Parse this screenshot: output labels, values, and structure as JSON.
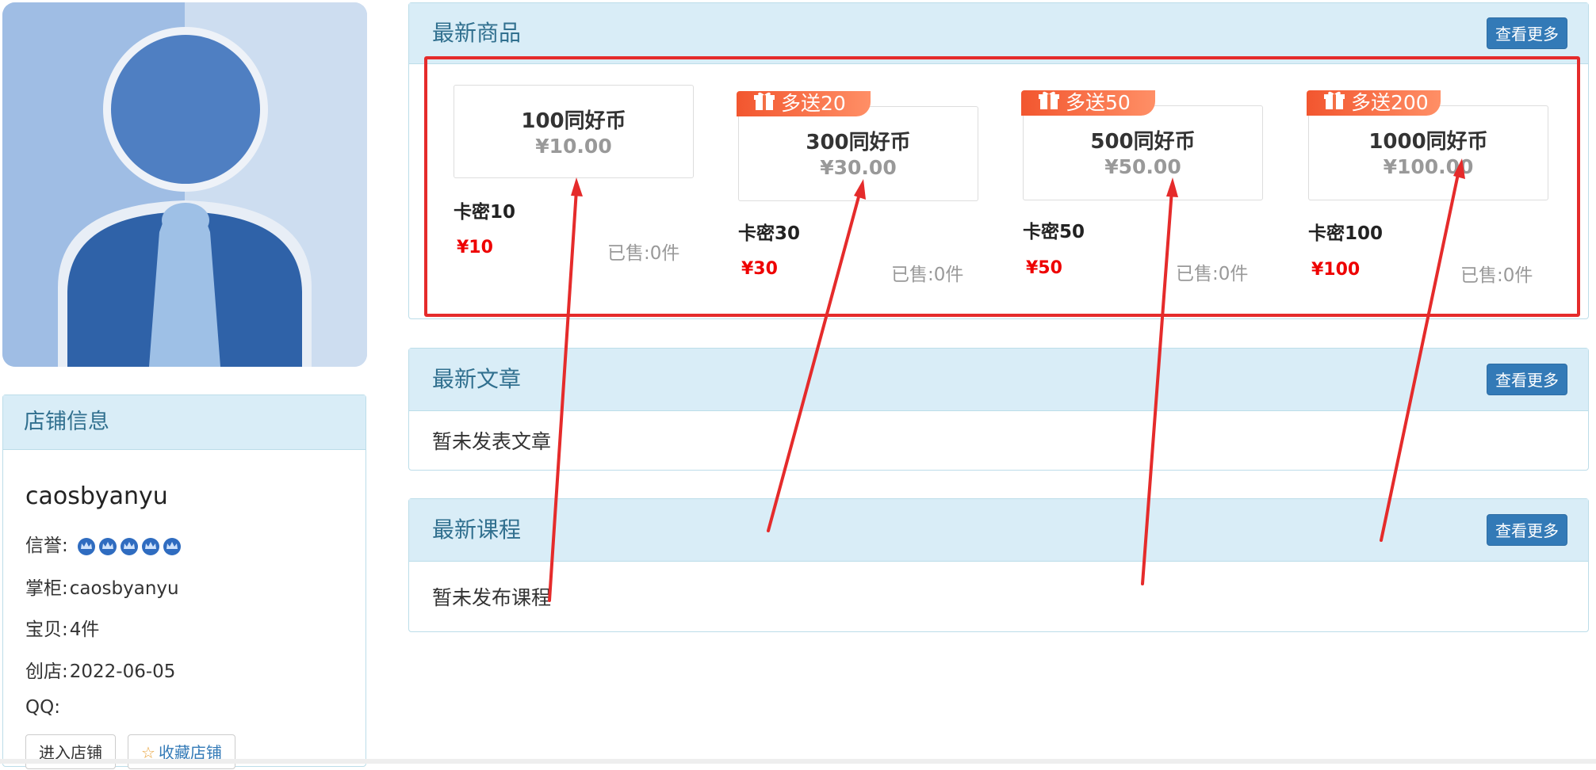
{
  "shop_panel": {
    "title": "店铺信息",
    "name": "caosbyanyu",
    "reputation_label": "信誉:",
    "reputation_crowns": 5,
    "owner_label": "掌柜:",
    "owner": "caosbyanyu",
    "items_label": "宝贝:",
    "items": "4件",
    "created_label": "创店:",
    "created": "2022-06-05",
    "qq_label": "QQ:",
    "qq": "",
    "enter_button": "进入店铺",
    "favorite_button": "收藏店铺"
  },
  "goods_panel": {
    "title": "最新商品",
    "more_button": "查看更多",
    "items": [
      {
        "name": "100同好币",
        "price": "¥10.00",
        "title": "卡密10",
        "sale_price": "¥10",
        "sold": "已售:0件",
        "gift": ""
      },
      {
        "name": "300同好币",
        "price": "¥30.00",
        "title": "卡密30",
        "sale_price": "¥30",
        "sold": "已售:0件",
        "gift": "多送20"
      },
      {
        "name": "500同好币",
        "price": "¥50.00",
        "title": "卡密50",
        "sale_price": "¥50",
        "sold": "已售:0件",
        "gift": "多送50"
      },
      {
        "name": "1000同好币",
        "price": "¥100.00",
        "title": "卡密100",
        "sale_price": "¥100",
        "sold": "已售:0件",
        "gift": "多送200"
      }
    ]
  },
  "articles_panel": {
    "title": "最新文章",
    "more_button": "查看更多",
    "empty_text": "暂未发表文章"
  },
  "courses_panel": {
    "title": "最新课程",
    "more_button": "查看更多",
    "empty_text": "暂未发布课程"
  },
  "colors": {
    "panel_heading_bg": "#d9edf7",
    "panel_heading_text": "#31708f",
    "primary_button": "#337ab7",
    "price_red": "#ee0000",
    "gift_tag": "#f2562f",
    "annotation_red": "#e52b2b"
  }
}
